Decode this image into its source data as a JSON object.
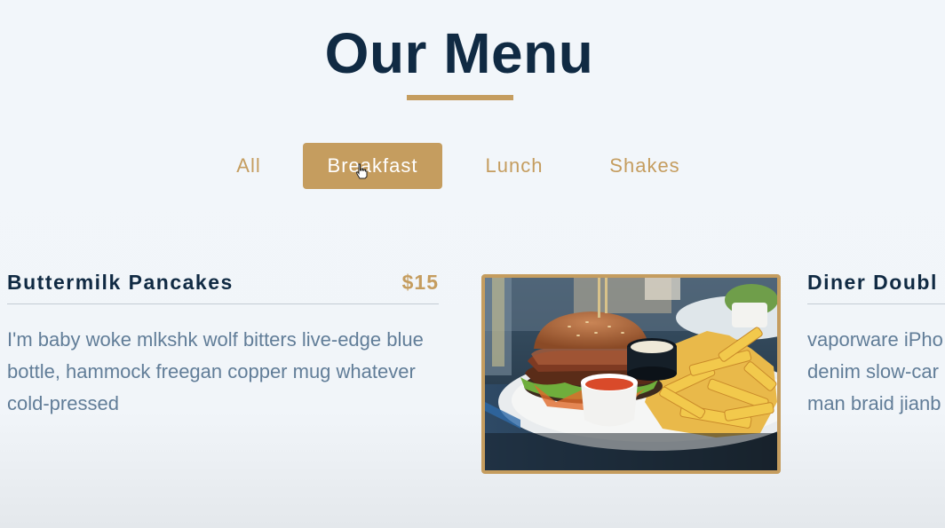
{
  "page": {
    "title": "Our Menu"
  },
  "filters": [
    {
      "label": "All",
      "active": false
    },
    {
      "label": "Breakfast",
      "active": true
    },
    {
      "label": "Lunch",
      "active": false
    },
    {
      "label": "Shakes",
      "active": false
    }
  ],
  "items": [
    {
      "name": "Buttermilk Pancakes",
      "price": "$15",
      "description": "I'm baby woke mlkshk wolf bitters live-edge blue bottle, hammock freegan copper mug whatever cold-pressed"
    },
    {
      "name": "Diner Doubl",
      "description_lines": [
        "vaporware iPho",
        "denim slow-car",
        "man braid jianb"
      ]
    }
  ],
  "colors": {
    "accent": "#c59d5f",
    "heading": "#102a43",
    "body_text": "#617d98",
    "background": "#f1f5f9"
  },
  "icons": {
    "cursor": "hand-pointer-icon"
  }
}
